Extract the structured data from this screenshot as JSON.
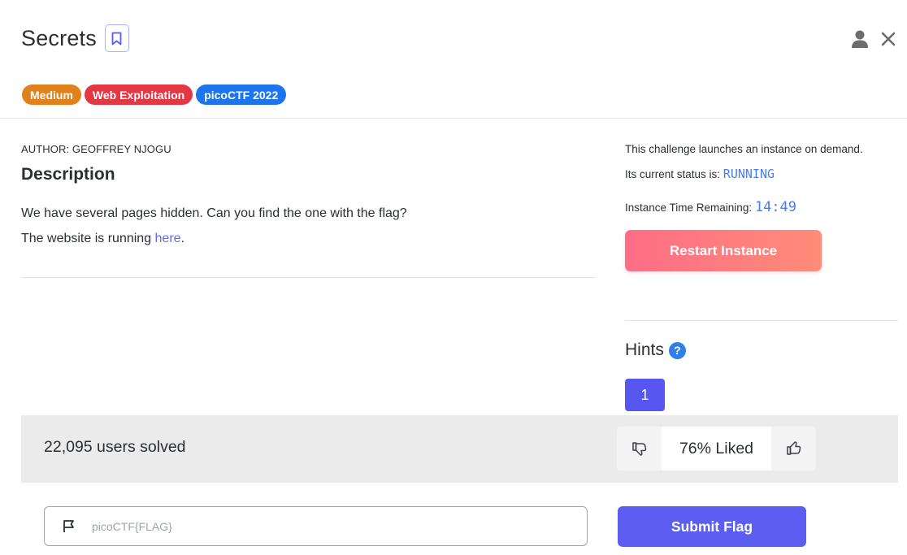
{
  "challenge": {
    "title": "Secrets",
    "tags": [
      {
        "label": "Medium",
        "color": "#e0811c"
      },
      {
        "label": "Web Exploitation",
        "color": "#e33744"
      },
      {
        "label": "picoCTF 2022",
        "color": "#1c75ec"
      }
    ],
    "author": "AUTHOR: GEOFFREY NJOGU",
    "description_heading": "Description",
    "description_line1": "We have several pages hidden. Can you find the one with the flag?",
    "description_line2_prefix": "The website is running ",
    "description_link": "here",
    "description_line2_suffix": "."
  },
  "instance": {
    "launch_text": "This challenge launches an instance on demand.",
    "status_label": "Its current status is: ",
    "status_value": "RUNNING",
    "time_label": "Instance Time Remaining: ",
    "time_value": "14:49",
    "restart_label": "Restart Instance"
  },
  "hints": {
    "label": "Hints",
    "help_glyph": "?",
    "items": [
      "1"
    ]
  },
  "stats": {
    "solved": "22,095 users solved",
    "liked": "76% Liked"
  },
  "flag_form": {
    "placeholder": "picoCTF{FLAG}",
    "submit_label": "Submit Flag"
  },
  "icons": {
    "bookmark": "bookmark-icon",
    "user": "user-icon",
    "close": "close-icon",
    "thumbs_down": "thumbs-down-icon",
    "thumbs_up": "thumbs-up-icon",
    "flag": "flag-icon"
  }
}
